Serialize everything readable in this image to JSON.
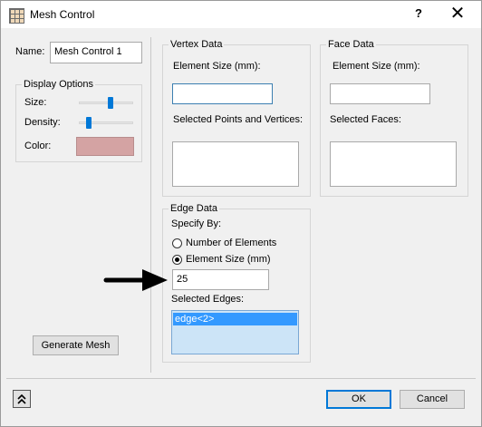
{
  "window": {
    "title": "Mesh Control",
    "help": "?",
    "close": "✕"
  },
  "left": {
    "name_label": "Name:",
    "name_value": "Mesh Control 1",
    "display_options": {
      "title": "Display Options",
      "size_label": "Size:",
      "size_level": 0.6,
      "density_label": "Density:",
      "density_level": 0.15,
      "color_label": "Color:",
      "color_swatch": "#d4a3a3"
    },
    "generate_button": "Generate Mesh"
  },
  "vertex": {
    "title": "Vertex Data",
    "element_size_label": "Element Size (mm):",
    "element_size_value": "",
    "selected_label": "Selected Points and Vertices:"
  },
  "face": {
    "title": "Face Data",
    "element_size_label": "Element Size (mm):",
    "element_size_value": "",
    "selected_label": "Selected Faces:"
  },
  "edge": {
    "title": "Edge Data",
    "specify_by_label": "Specify By:",
    "option_number": "Number of Elements",
    "option_size": "Element Size (mm)",
    "selected_option": "size",
    "size_value": "25",
    "selected_edges_label": "Selected Edges:",
    "selected_edges": [
      "edge<2>"
    ]
  },
  "footer": {
    "expand_icon": "double-chevron-up-icon",
    "ok": "OK",
    "cancel": "Cancel"
  }
}
